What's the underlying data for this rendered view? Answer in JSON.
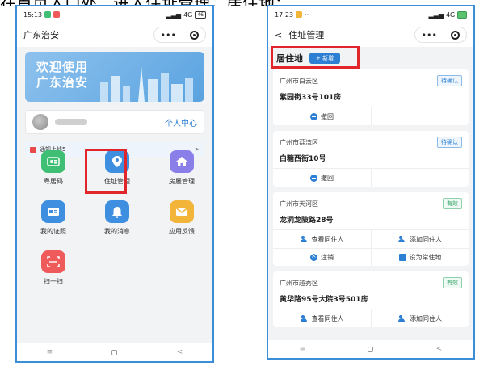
{
  "caption": "在首页入口处，进入住址管理，居住地：",
  "left_phone": {
    "status_time": "15:13",
    "status_signal": "4G",
    "status_battery": "46",
    "title": "广东治安",
    "capsule_dots": "•••",
    "banner_line1": "欢迎使用",
    "banner_line2": "广东治安",
    "user_center": "个人中心",
    "notice": "通知上线5",
    "notice_arrow": ">",
    "apps": [
      {
        "label": "粤居码",
        "color": "#3fbf74"
      },
      {
        "label": "住址管理",
        "color": "#3f8fe0"
      },
      {
        "label": "房屋管理",
        "color": "#8a7ee8"
      },
      {
        "label": "我的证照",
        "color": "#3f8fe0"
      },
      {
        "label": "我的消息",
        "color": "#3f8fe0"
      },
      {
        "label": "应用反馈",
        "color": "#f2b53a"
      },
      {
        "label": "扫一扫",
        "color": "#ef5a5a"
      }
    ],
    "nav": {
      "menu": "≡",
      "back": "<"
    }
  },
  "right_phone": {
    "status_time": "17:23",
    "status_extra": "··",
    "status_signal": "4G",
    "back_arrow": "<",
    "title": "住址管理",
    "capsule_dots": "•••",
    "section_title": "居住地",
    "add_button": "+ 新增",
    "cards": [
      {
        "district": "广州市白云区",
        "status": "待确认",
        "detail": "紫园街33号101房"
      },
      {
        "district": "广州市荔湾区",
        "status": "待确认",
        "detail": "白糖西街10号"
      },
      {
        "district": "广州市天河区",
        "status": "有效",
        "detail": "龙洞龙陂路28号"
      },
      {
        "district": "广州市越秀区",
        "status": "有效",
        "detail": "黄华路95号大院3号501房"
      }
    ],
    "actions": {
      "revoke": "撤回",
      "view_cohabitant": "查看同住人",
      "add_cohabitant": "添加同住人",
      "cancel": "注销",
      "set_usual": "设为常住地"
    },
    "nav": {
      "menu": "≡",
      "back": "<"
    }
  }
}
